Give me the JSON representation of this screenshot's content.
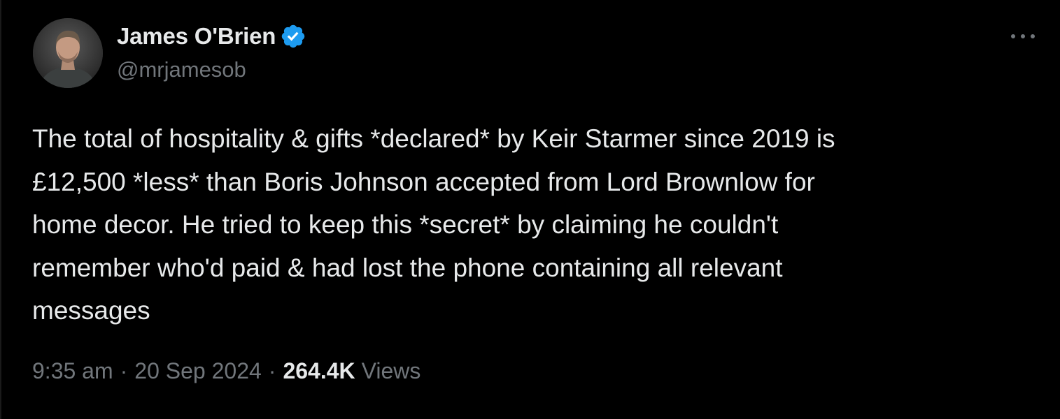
{
  "author": {
    "display_name": "James O'Brien",
    "handle": "@mrjamesob",
    "verified_color": "#1d9bf0"
  },
  "tweet": {
    "text": "The total of hospitality & gifts *declared* by Keir Starmer since 2019 is\n£12,500 *less* than Boris Johnson accepted from Lord Brownlow for\nhome decor. He tried to keep this *secret* by claiming he couldn't\nremember who'd paid & had lost the phone containing all relevant\nmessages",
    "time": "9:35 am",
    "separator": "·",
    "date": "20 Sep 2024",
    "views_count": "264.4K",
    "views_label": "Views"
  },
  "icons": {
    "avatar": "avatar",
    "verified": "verified-badge-icon",
    "more": "more-options-icon"
  },
  "colors": {
    "background": "#000000",
    "text_primary": "#e7e9ea",
    "text_secondary": "#71767b",
    "accent": "#1d9bf0"
  }
}
